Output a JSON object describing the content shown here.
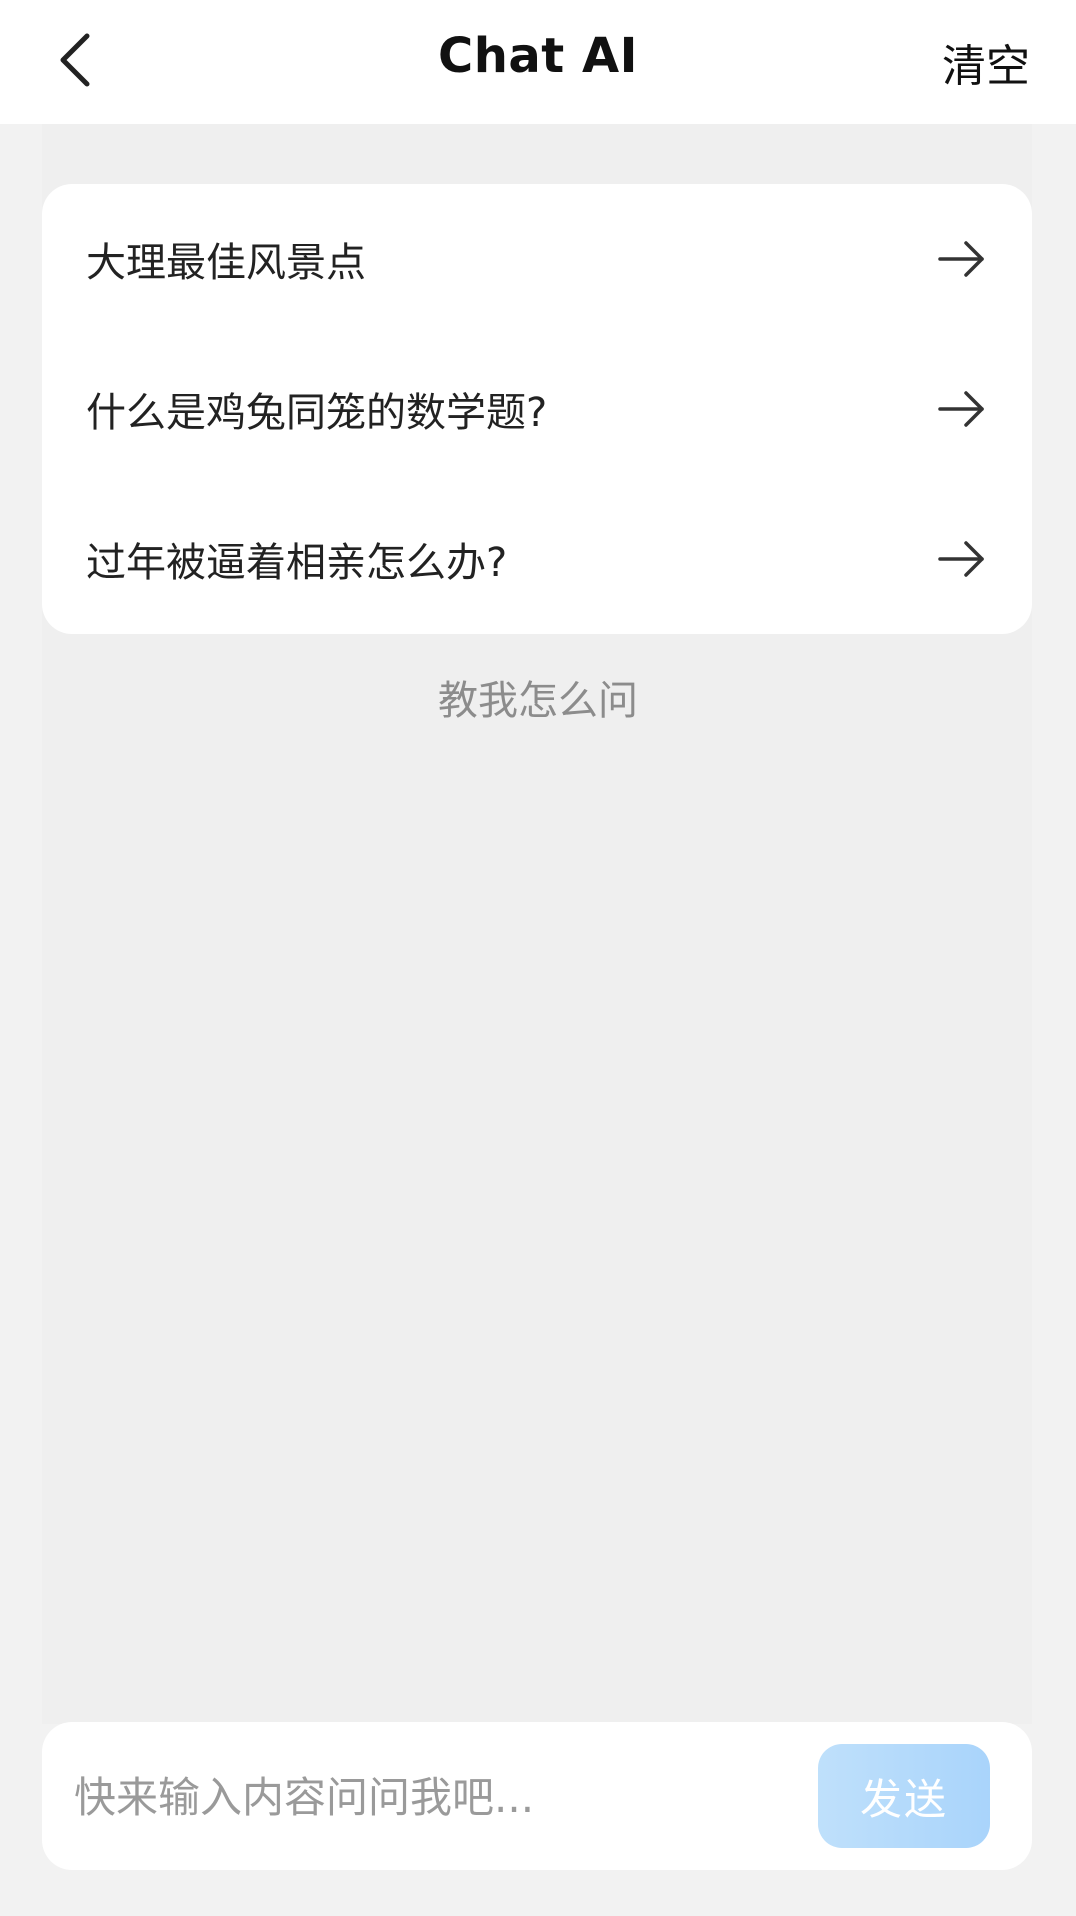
{
  "header": {
    "back_icon": "chevron-left-icon",
    "title": "Chat AI",
    "clear_label": "清空"
  },
  "suggestions": {
    "items": [
      {
        "label": "大理最佳风景点",
        "icon": "arrow-right-icon"
      },
      {
        "label": "什么是鸡兔同笼的数学题?",
        "icon": "arrow-right-icon"
      },
      {
        "label": "过年被逼着相亲怎么办?",
        "icon": "arrow-right-icon"
      }
    ]
  },
  "teach_link": "教我怎么问",
  "composer": {
    "placeholder": "快来输入内容问问我吧...",
    "value": "",
    "send_label": "发送"
  },
  "colors": {
    "page_background": "#f2f2f2",
    "card_background": "#ffffff",
    "send_button": "#a9d4fb",
    "muted_text": "#8c8c8c"
  }
}
